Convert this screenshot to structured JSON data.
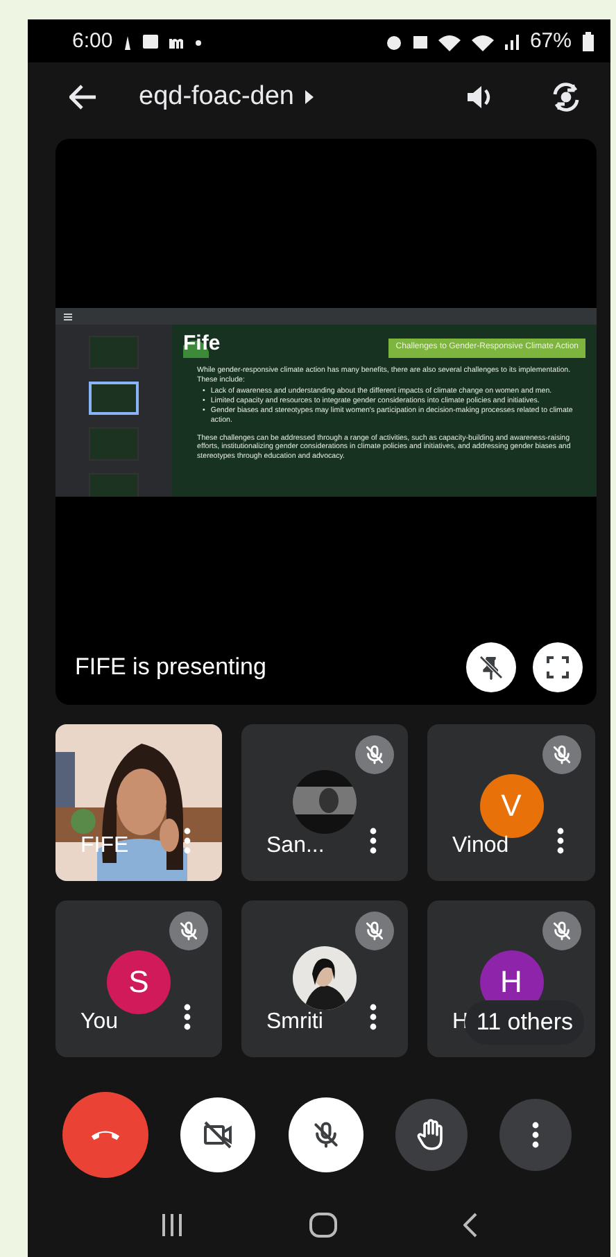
{
  "status_bar": {
    "time": "6:00",
    "battery": "67%"
  },
  "header": {
    "meeting_code": "eqd-foac-den"
  },
  "presentation": {
    "caption": "FIFE is presenting",
    "slide": {
      "logo": "Fife",
      "title": "Challenges to Gender-Responsive Climate Action",
      "intro": "While gender-responsive climate action has many benefits, there are also several challenges to its implementation. These include:",
      "bullet_marker": "•",
      "bullets": [
        "Lack of awareness and understanding about the different impacts of climate change on women and men.",
        "Limited capacity and resources to integrate gender considerations into climate policies and initiatives.",
        "Gender biases and stereotypes may limit women's participation in decision-making processes related to climate action."
      ],
      "closing": "These challenges can be addressed through a range of activities, such as capacity-building and awareness-raising efforts, institutionalizing gender considerations in climate policies and initiatives, and addressing gender biases and stereotypes through education and advocacy.",
      "thumbnails": [
        {
          "selected": false
        },
        {
          "selected": true
        },
        {
          "selected": false
        },
        {
          "selected": false
        }
      ]
    }
  },
  "participants": [
    {
      "name": "FIFE",
      "kind": "video",
      "muted": false
    },
    {
      "name": "San...",
      "muted": true
    },
    {
      "name": "Vinod",
      "kind": "letter",
      "initial": "V",
      "color": "#e8710a",
      "muted": true
    },
    {
      "name": "You",
      "kind": "letter",
      "initial": "S",
      "color": "#d01a5a",
      "muted": true
    },
    {
      "name": "Smriti",
      "muted": true
    },
    {
      "name": "H",
      "kind": "letter",
      "initial": "H",
      "color": "#8e24aa",
      "muted": true,
      "overlay": "11 others"
    }
  ],
  "controls": [
    {
      "kind": "end_call"
    },
    {
      "kind": "camera",
      "on": false
    },
    {
      "kind": "mic",
      "on": false
    },
    {
      "kind": "hand"
    },
    {
      "kind": "more"
    }
  ]
}
